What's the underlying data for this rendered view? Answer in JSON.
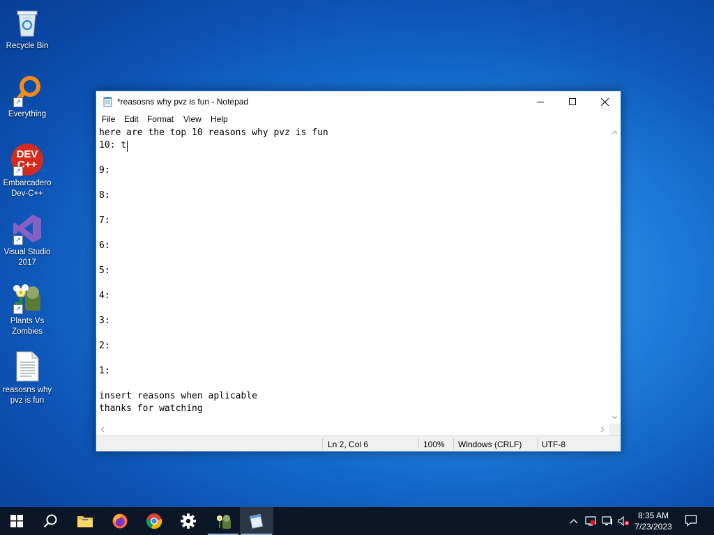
{
  "desktop": {
    "icons": [
      {
        "label": "Recycle Bin",
        "icon": "recycle-bin-icon"
      },
      {
        "label": "Everything",
        "icon": "everything-search-icon"
      },
      {
        "label": "Embarcadero Dev-C++",
        "icon": "dev-cpp-icon",
        "badge": "DEV C++"
      },
      {
        "label": "Visual Studio 2017",
        "icon": "visual-studio-icon"
      },
      {
        "label": "Plants Vs Zombies",
        "icon": "plants-vs-zombies-icon"
      },
      {
        "label": "reasosns why pvz is fun",
        "icon": "text-file-icon"
      }
    ]
  },
  "notepad": {
    "title": "*reasosns why pvz is fun - Notepad",
    "menu": [
      "File",
      "Edit",
      "Format",
      "View",
      "Help"
    ],
    "lines": [
      "here are the top 10 reasons why pvz is fun",
      "10: t",
      "",
      "9:",
      "",
      "8:",
      "",
      "7:",
      "",
      "6:",
      "",
      "5:",
      "",
      "4:",
      "",
      "3:",
      "",
      "2:",
      "",
      "1:",
      "",
      "insert reasons when aplicable",
      "thanks for watching"
    ],
    "status": {
      "position": "Ln 2, Col 6",
      "zoom": "100%",
      "line_ending": "Windows (CRLF)",
      "encoding": "UTF-8"
    }
  },
  "taskbar": {
    "apps": [
      "start",
      "search",
      "file-explorer",
      "firefox",
      "chrome",
      "settings",
      "plants-vs-zombies",
      "notepad"
    ],
    "active_app": "notepad",
    "clock": {
      "time": "8:35 AM",
      "date": "7/23/2023"
    }
  },
  "colors": {
    "desktop_blue": "#1674d6",
    "taskbar": "#0b1626",
    "window_border": "#1e74c9"
  }
}
